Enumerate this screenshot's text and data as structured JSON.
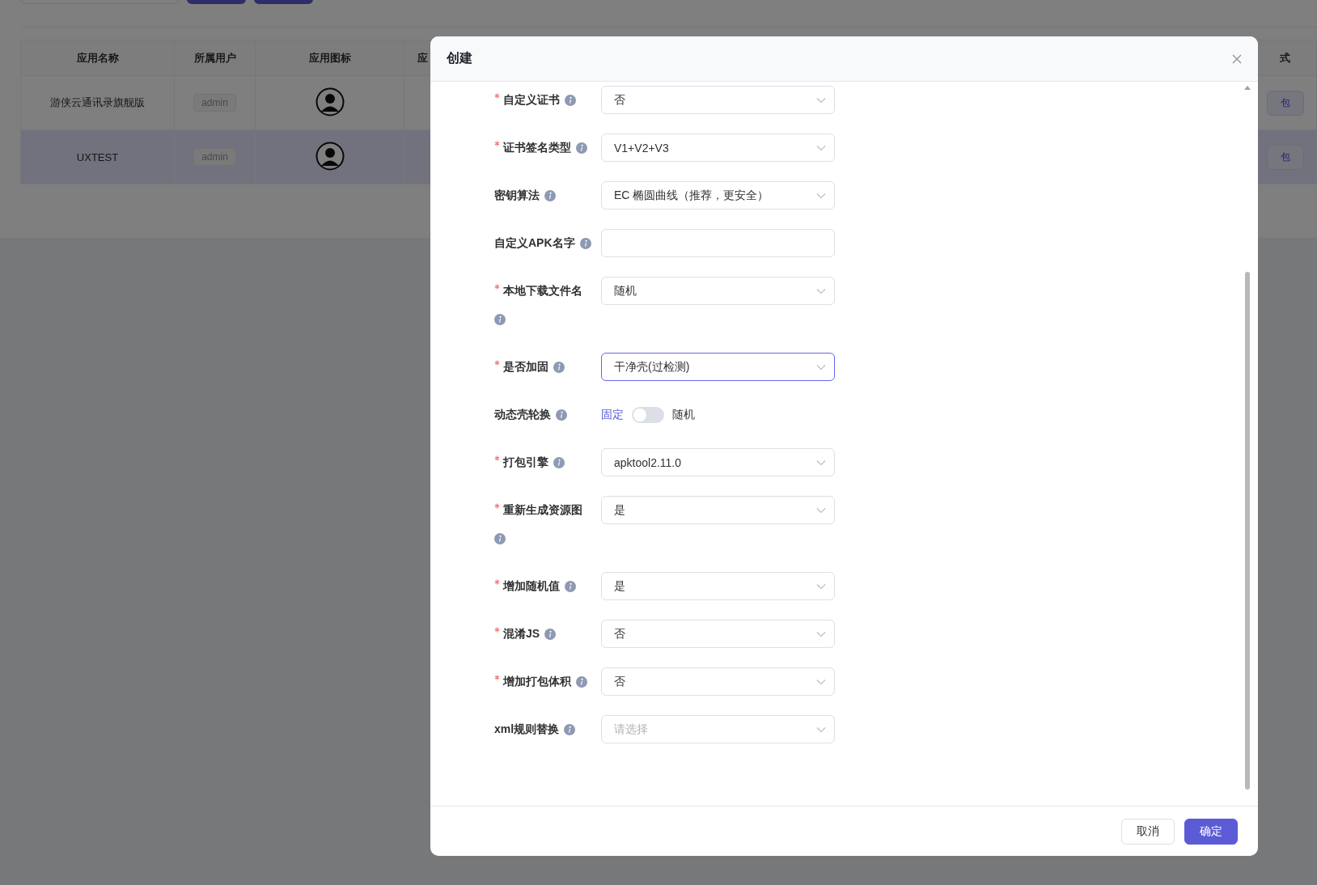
{
  "table": {
    "columns": [
      "应用名称",
      "所属用户",
      "应用图标",
      "应",
      "式"
    ],
    "rows": [
      {
        "name": "游侠云通讯录旗舰版",
        "user": "admin",
        "action": "包",
        "selected": false
      },
      {
        "name": "UXTEST",
        "user": "admin",
        "action": "包",
        "selected": true
      }
    ]
  },
  "dialog": {
    "title": "创建",
    "fields": [
      {
        "kind": "select",
        "label": "自定义证书",
        "required": true,
        "value": "否",
        "focused": false
      },
      {
        "kind": "select",
        "label": "证书签名类型",
        "required": true,
        "value": "V1+V2+V3",
        "focused": false
      },
      {
        "kind": "select",
        "label": "密钥算法",
        "required": false,
        "value": "EC 椭圆曲线（推荐，更安全）",
        "focused": false
      },
      {
        "kind": "input",
        "label": "自定义APK名字",
        "required": false
      },
      {
        "kind": "select",
        "label": "本地下载文件名",
        "required": true,
        "value": "随机",
        "focused": false
      },
      {
        "kind": "select",
        "label": "是否加固",
        "required": true,
        "value": "干净壳(过检测)",
        "focused": true
      },
      {
        "kind": "switch",
        "label": "动态壳轮换",
        "required": false,
        "off_text": "固定",
        "on_text": "随机",
        "on": false
      },
      {
        "kind": "select",
        "label": "打包引擎",
        "required": true,
        "value": "apktool2.11.0",
        "focused": false
      },
      {
        "kind": "select",
        "label": "重新生成资源图",
        "required": true,
        "value": "是",
        "focused": false
      },
      {
        "kind": "select",
        "label": "增加随机值",
        "required": true,
        "value": "是",
        "focused": false
      },
      {
        "kind": "select",
        "label": "混淆JS",
        "required": true,
        "value": "否",
        "focused": false
      },
      {
        "kind": "select",
        "label": "增加打包体积",
        "required": true,
        "value": "否",
        "focused": false
      },
      {
        "kind": "select",
        "label": "xml规则替换",
        "required": false,
        "placeholder": "请选择",
        "focused": false
      }
    ],
    "buttons": [
      {
        "label": "取消",
        "primary": false
      },
      {
        "label": "确定",
        "primary": true
      }
    ]
  }
}
